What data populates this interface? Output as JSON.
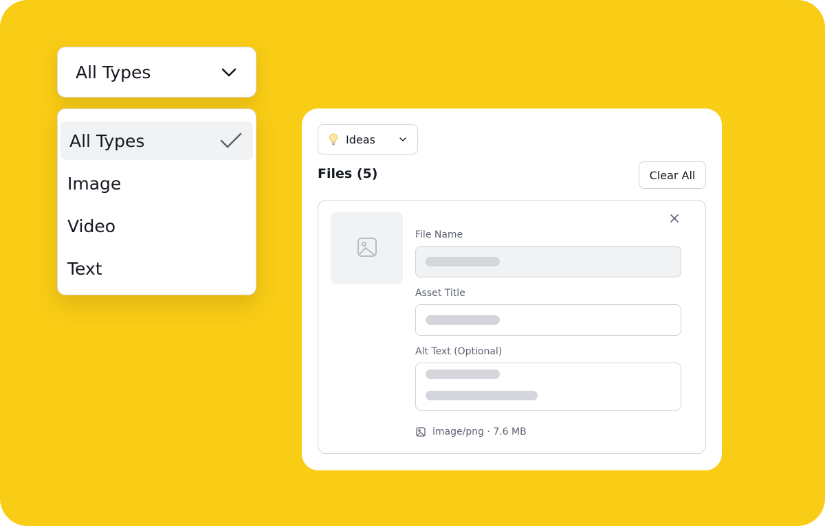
{
  "type_filter": {
    "selected_label": "All Types",
    "options": [
      {
        "label": "All Types",
        "selected": true
      },
      {
        "label": "Image",
        "selected": false
      },
      {
        "label": "Video",
        "selected": false
      },
      {
        "label": "Text",
        "selected": false
      }
    ]
  },
  "files_panel": {
    "folder": {
      "label": "Ideas",
      "icon": "lightbulb-icon"
    },
    "title": "Files (5)",
    "clear_all_label": "Clear All",
    "file": {
      "file_name_label": "File Name",
      "asset_title_label": "Asset Title",
      "alt_text_label": "Alt Text (Optional)",
      "meta": "image/png · 7.6 MB"
    }
  },
  "colors": {
    "background": "#F9CC16",
    "text": "#141821",
    "muted_text": "#5C6270",
    "border": "#D0D2D6",
    "skeleton": "#D4D6DB",
    "selected_row": "#F1F2F4"
  }
}
